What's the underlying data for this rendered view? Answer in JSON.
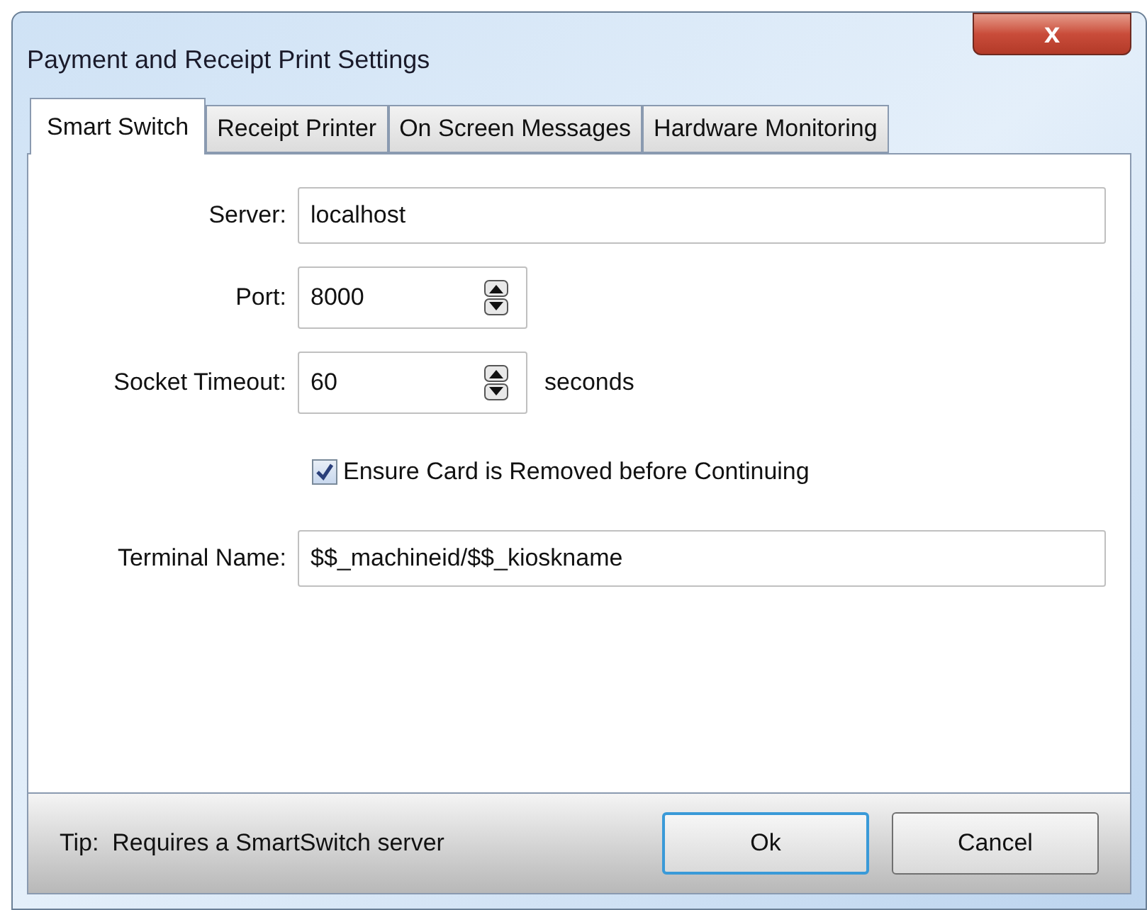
{
  "window": {
    "title": "Payment and Receipt Print Settings",
    "close": "x"
  },
  "tabs": [
    {
      "label": "Smart Switch",
      "selected": true
    },
    {
      "label": "Receipt Printer",
      "selected": false
    },
    {
      "label": "On Screen Messages",
      "selected": false
    },
    {
      "label": "Hardware Monitoring",
      "selected": false
    }
  ],
  "fields": [
    {
      "kind": "text",
      "label": "Server:",
      "value": "localhost"
    },
    {
      "kind": "spin",
      "label": "Port:",
      "value": "8000"
    },
    {
      "kind": "spin",
      "label": "Socket Timeout:",
      "value": "60",
      "unit": "seconds"
    },
    {
      "kind": "check",
      "label": "Ensure Card is Removed before Continuing",
      "checked": true
    },
    {
      "kind": "text",
      "label": "Terminal Name:",
      "value": "$$_machineid/$$_kioskname"
    }
  ],
  "tip": "Tip:  Requires a SmartSwitch server",
  "buttons": [
    {
      "label": "Ok",
      "selected": true
    },
    {
      "label": "Cancel",
      "selected": false
    }
  ]
}
